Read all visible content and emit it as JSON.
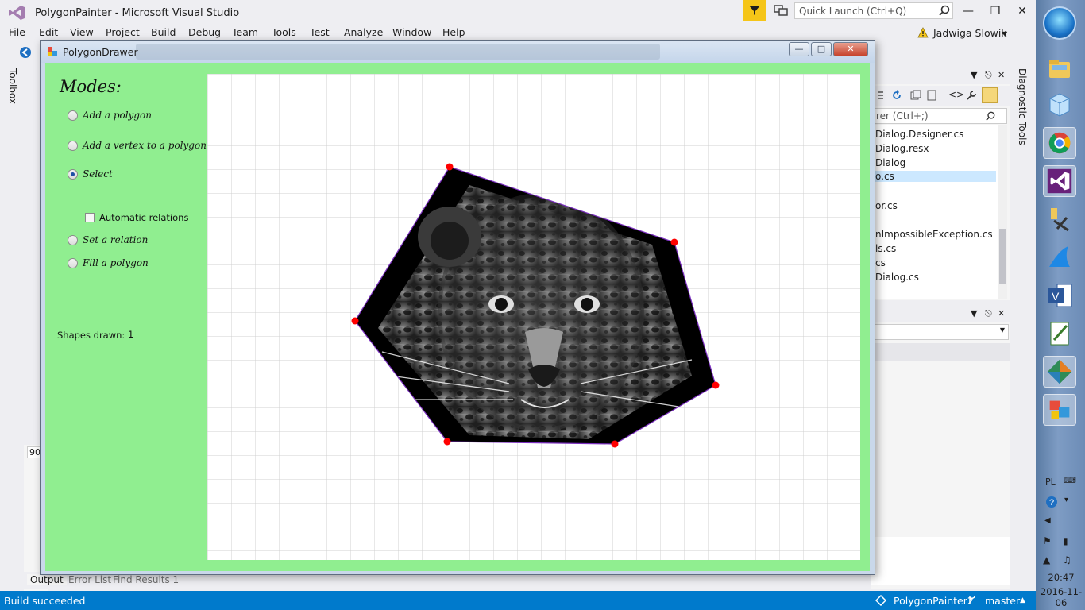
{
  "vs": {
    "title": "PolygonPainter - Microsoft Visual Studio",
    "quick_launch_placeholder": "Quick Launch (Ctrl+Q)",
    "menu": [
      "File",
      "Edit",
      "View",
      "Project",
      "Build",
      "Debug",
      "Team",
      "Tools",
      "Test",
      "Analyze",
      "Window",
      "Help"
    ],
    "user": "Jadwiga Slowik",
    "toolbox_label": "Toolbox",
    "diagnostic_label": "Diagnostic Tools",
    "status": "Build succeeded",
    "branch_repo": "PolygonPainter2",
    "branch": "master",
    "accent_color": "#007acc"
  },
  "solution_explorer": {
    "search_placeholder": "rer (Ctrl+;)",
    "items": [
      "Dialog.Designer.cs",
      "Dialog.resx",
      "Dialog",
      "o.cs",
      "",
      "or.cs",
      "",
      "nImpossibleException.cs",
      "ls.cs",
      "cs",
      "Dialog.cs"
    ]
  },
  "output_fragment": {
    "zoom": "90",
    "tabs": [
      "Output",
      "Error List",
      "Find Results 1"
    ]
  },
  "taskbar": {
    "lang": "PL",
    "time": "20:47",
    "date": "2016-11-06"
  },
  "polygon_drawer": {
    "title": "PolygonDrawer",
    "modes_title": "Modes:",
    "modes": [
      {
        "label": "Add a polygon",
        "checked": false
      },
      {
        "label": "Add a vertex to a polygon",
        "checked": false
      },
      {
        "label": "Select",
        "checked": true
      },
      {
        "label": "Set a relation",
        "checked": false
      },
      {
        "label": "Fill a polygon",
        "checked": false
      }
    ],
    "automatic_relations_label": "Automatic relations",
    "automatic_relations_checked": false,
    "shapes_drawn_label": "Shapes drawn:",
    "shapes_drawn_value": "1",
    "background_color": "#90ee90",
    "vertex_color": "#ff0000",
    "edge_color": "#7b2fbf",
    "fill": "leopard-photo"
  }
}
